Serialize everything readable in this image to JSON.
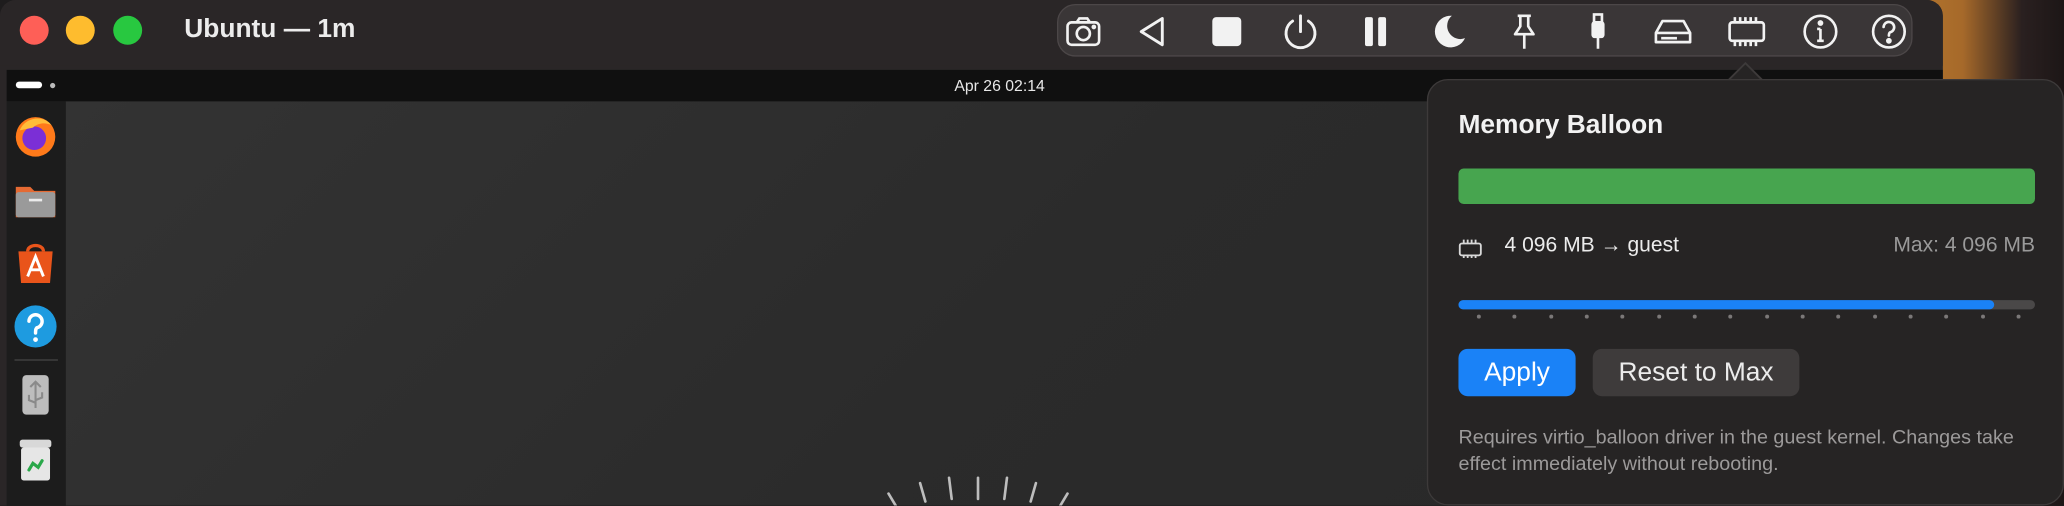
{
  "window": {
    "title": "Ubuntu — 1m"
  },
  "toolbar": {
    "items": [
      {
        "name": "screenshot",
        "icon": "camera-icon"
      },
      {
        "name": "back",
        "icon": "triangle-left-icon"
      },
      {
        "name": "stop",
        "icon": "stop-icon"
      },
      {
        "name": "power",
        "icon": "power-icon"
      },
      {
        "name": "pause",
        "icon": "pause-icon"
      },
      {
        "name": "sleep",
        "icon": "moon-icon"
      },
      {
        "name": "pin",
        "icon": "pin-icon"
      },
      {
        "name": "usb",
        "icon": "usb-plug-icon"
      },
      {
        "name": "drive",
        "icon": "drive-icon"
      },
      {
        "name": "memory",
        "icon": "memory-chip-icon"
      },
      {
        "name": "info",
        "icon": "info-icon"
      },
      {
        "name": "help",
        "icon": "question-icon"
      }
    ]
  },
  "guest": {
    "clock": "Apr 26  02:14",
    "dock": [
      {
        "name": "firefox",
        "icon": "firefox-icon"
      },
      {
        "name": "files",
        "icon": "folder-icon"
      },
      {
        "name": "app-center",
        "icon": "app-store-icon"
      },
      {
        "name": "help",
        "icon": "help-icon"
      },
      {
        "name": "usb-drive",
        "icon": "usb-drive-icon"
      },
      {
        "name": "trash",
        "icon": "trash-icon"
      }
    ]
  },
  "popover": {
    "title": "Memory Balloon",
    "usage_fraction": 1.0,
    "current": "4 096 MB → guest",
    "max": "Max: 4 096 MB",
    "slider_fraction": 0.93,
    "tick_count": 16,
    "apply_label": "Apply",
    "reset_label": "Reset to Max",
    "note": "Requires virtio_balloon driver in the guest kernel. Changes take effect immediately without rebooting."
  },
  "colors": {
    "accent": "#1a82f7",
    "usage_bar": "#47a54f",
    "traffic_red": "#fe5f57",
    "traffic_yellow": "#febc2e",
    "traffic_green": "#28c840"
  }
}
